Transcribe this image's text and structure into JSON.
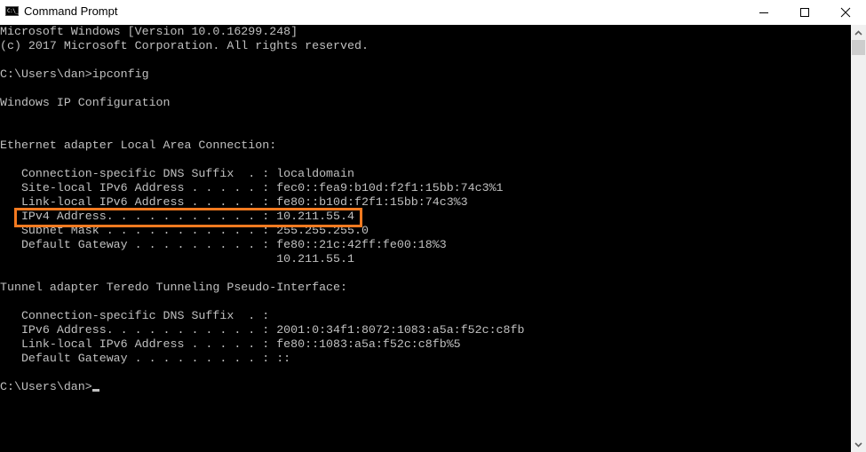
{
  "window": {
    "title": "Command Prompt",
    "icon": "cmd-icon",
    "icon_text": "C:\\_",
    "controls": [
      "minimize-icon",
      "maximize-icon",
      "close-icon"
    ]
  },
  "console": {
    "lines": [
      "Microsoft Windows [Version 10.0.16299.248]",
      "(c) 2017 Microsoft Corporation. All rights reserved.",
      "",
      "C:\\Users\\dan>ipconfig",
      "",
      "Windows IP Configuration",
      "",
      "",
      "Ethernet adapter Local Area Connection:",
      "",
      "   Connection-specific DNS Suffix  . : localdomain",
      "   Site-local IPv6 Address . . . . . : fec0::fea9:b10d:f2f1:15bb:74c3%1",
      "   Link-local IPv6 Address . . . . . : fe80::b10d:f2f1:15bb:74c3%3",
      "   IPv4 Address. . . . . . . . . . . : 10.211.55.4",
      "   Subnet Mask . . . . . . . . . . . : 255.255.255.0",
      "   Default Gateway . . . . . . . . . : fe80::21c:42ff:fe00:18%3",
      "                                       10.211.55.1",
      "",
      "Tunnel adapter Teredo Tunneling Pseudo-Interface:",
      "",
      "   Connection-specific DNS Suffix  . :",
      "   IPv6 Address. . . . . . . . . . . : 2001:0:34f1:8072:1083:a5a:f52c:c8fb",
      "   Link-local IPv6 Address . . . . . : fe80::1083:a5a:f52c:c8fb%5",
      "   Default Gateway . . . . . . . . . : ::",
      ""
    ],
    "prompt": "C:\\Users\\dan>",
    "highlighted_line": "   IPv4 Address. . . . . . . . . . . : 10.211.55.4",
    "highlight_color": "#f47a20",
    "text_color": "#c0c0c0",
    "background_color": "#000000"
  }
}
